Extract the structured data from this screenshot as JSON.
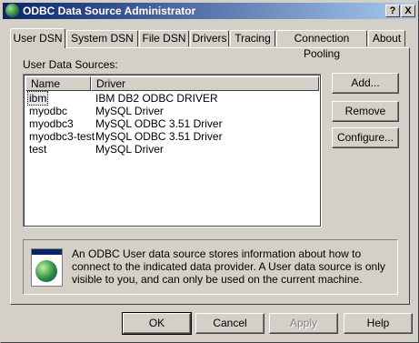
{
  "window": {
    "title": "ODBC Data Source Administrator",
    "help_button": "?",
    "close_button": "X"
  },
  "tabs": [
    {
      "label": "User DSN",
      "active": true
    },
    {
      "label": "System DSN",
      "active": false
    },
    {
      "label": "File DSN",
      "active": false
    },
    {
      "label": "Drivers",
      "active": false
    },
    {
      "label": "Tracing",
      "active": false
    },
    {
      "label": "Connection Pooling",
      "active": false
    },
    {
      "label": "About",
      "active": false
    }
  ],
  "user_dsn": {
    "section_label": "User Data Sources:",
    "columns": [
      "Name",
      "Driver"
    ],
    "rows": [
      {
        "name": "ibm",
        "driver": "IBM DB2 ODBC DRIVER",
        "selected": true
      },
      {
        "name": "myodbc",
        "driver": "MySQL Driver",
        "selected": false
      },
      {
        "name": "myodbc3",
        "driver": "MySQL ODBC 3.51 Driver",
        "selected": false
      },
      {
        "name": "myodbc3-test",
        "driver": "MySQL ODBC 3.51 Driver",
        "selected": false
      },
      {
        "name": "test",
        "driver": "MySQL Driver",
        "selected": false
      }
    ],
    "buttons": {
      "add": "Add...",
      "remove": "Remove",
      "configure": "Configure..."
    },
    "info_text": "An ODBC User data source stores information about how to connect to the indicated data provider.   A User data source is only visible to you, and can only be used on the current machine."
  },
  "footer_buttons": {
    "ok": "OK",
    "cancel": "Cancel",
    "apply": "Apply",
    "help": "Help"
  }
}
